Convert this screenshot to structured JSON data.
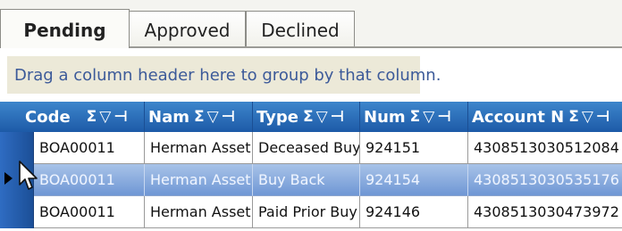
{
  "tabs": [
    {
      "label": "Pending",
      "active": true
    },
    {
      "label": "Approved",
      "active": false
    },
    {
      "label": "Declined",
      "active": false
    }
  ],
  "group_prompt": "Drag a column header here to group by that column.",
  "grid": {
    "columns": [
      {
        "label": "Code",
        "key": "code"
      },
      {
        "label": "Nam",
        "key": "name"
      },
      {
        "label": "Type",
        "key": "type"
      },
      {
        "label": "Num",
        "key": "num"
      },
      {
        "label": "Account N",
        "key": "account"
      }
    ],
    "header_icons": [
      "sum-icon",
      "filter-icon",
      "pin-icon"
    ],
    "rows": [
      {
        "code": "BOA00011",
        "name": "Herman Asset",
        "type": "Deceased Buy",
        "num": "924151",
        "account": "4308513030512084",
        "selected": false
      },
      {
        "code": "BOA00011",
        "name": "Herman Asset",
        "type": "Buy Back",
        "num": "924154",
        "account": "4308513030535176",
        "selected": true
      },
      {
        "code": "BOA00011",
        "name": "Herman Asset",
        "type": "Paid Prior Buy",
        "num": "924146",
        "account": "4308513030473972",
        "selected": false
      }
    ]
  },
  "colors": {
    "header_top": "#3d86cc",
    "header_bottom": "#1d5aa7",
    "group_area": "#ece9d8",
    "group_text": "#3c5a99",
    "selected_row_top": "#a8c3e8",
    "selected_row_bottom": "#6d95d4"
  }
}
